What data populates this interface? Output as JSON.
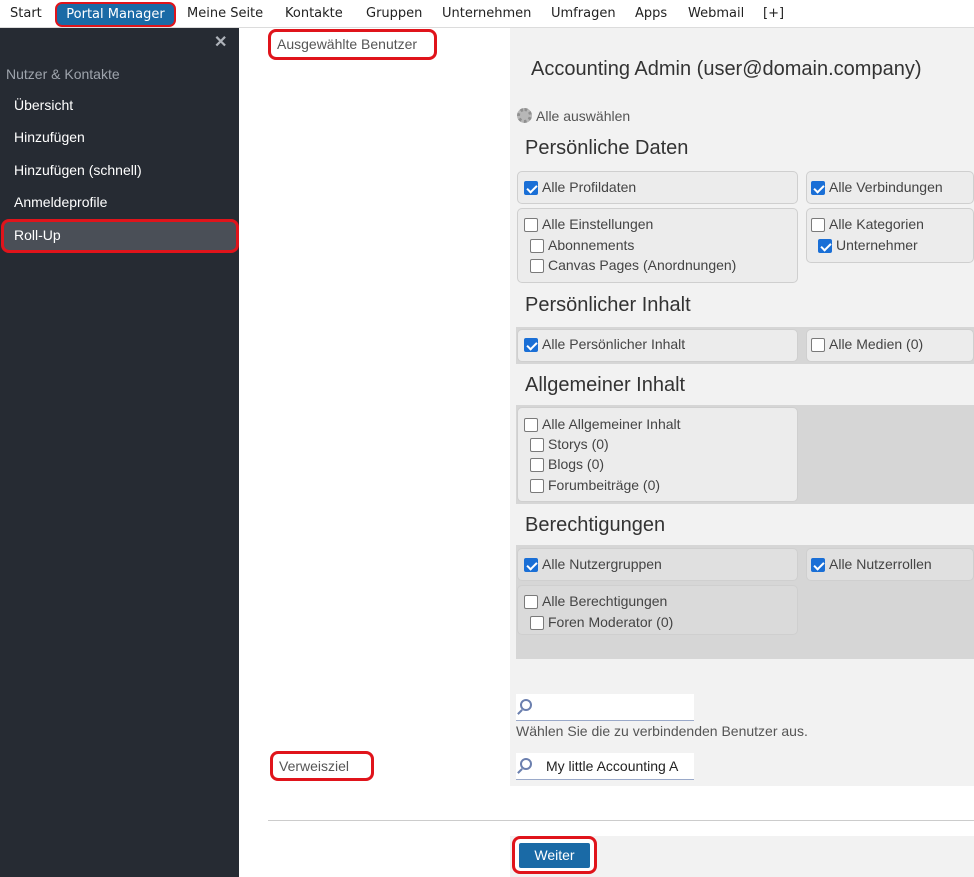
{
  "topnav": {
    "items": [
      "Start",
      "Portal Manager",
      "Meine Seite",
      "Kontakte",
      "Gruppen",
      "Unternehmen",
      "Umfragen",
      "Apps",
      "Webmail",
      "[+]"
    ]
  },
  "sidebar": {
    "close": "✕",
    "heading": "Nutzer & Kontakte",
    "links": [
      "Übersicht",
      "Hinzufügen",
      "Hinzufügen (schnell)",
      "Anmeldeprofile",
      "Roll-Up"
    ]
  },
  "form": {
    "selected_users_label": "Ausgewählte Benutzer",
    "user_title": "Accounting Admin (user@domain.company)",
    "select_all": "Alle auswählen",
    "sections": {
      "personal_data": "Persönliche Daten",
      "personal_content": "Persönlicher Inhalt",
      "general_content": "Allgemeiner Inhalt",
      "permissions": "Berechtigungen"
    },
    "checkboxes": {
      "all_profile": "Alle Profildaten",
      "all_connections": "Alle Verbindungen",
      "all_settings": "Alle Einstellungen",
      "subscriptions": "Abonnements",
      "canvas_pages": "Canvas Pages (Anordnungen)",
      "all_categories": "Alle Kategorien",
      "entrepreneur": "Unternehmer",
      "all_personal_content": "Alle Persönlicher Inhalt",
      "all_media": "Alle Medien (0)",
      "all_general_content": "Alle Allgemeiner Inhalt",
      "stories": "Storys (0)",
      "blogs": "Blogs (0)",
      "forum_posts": "Forumbeiträge (0)",
      "all_user_groups": "Alle Nutzergruppen",
      "all_user_roles": "Alle Nutzerrollen",
      "all_permissions": "Alle Berechtigungen",
      "forum_moderator": "Foren Moderator (0)"
    },
    "connect_hint": "Wählen Sie die zu verbindenden Benutzer aus.",
    "redirect_label": "Verweisziel",
    "redirect_value": "My little Accounting A",
    "submit": "Weiter"
  }
}
